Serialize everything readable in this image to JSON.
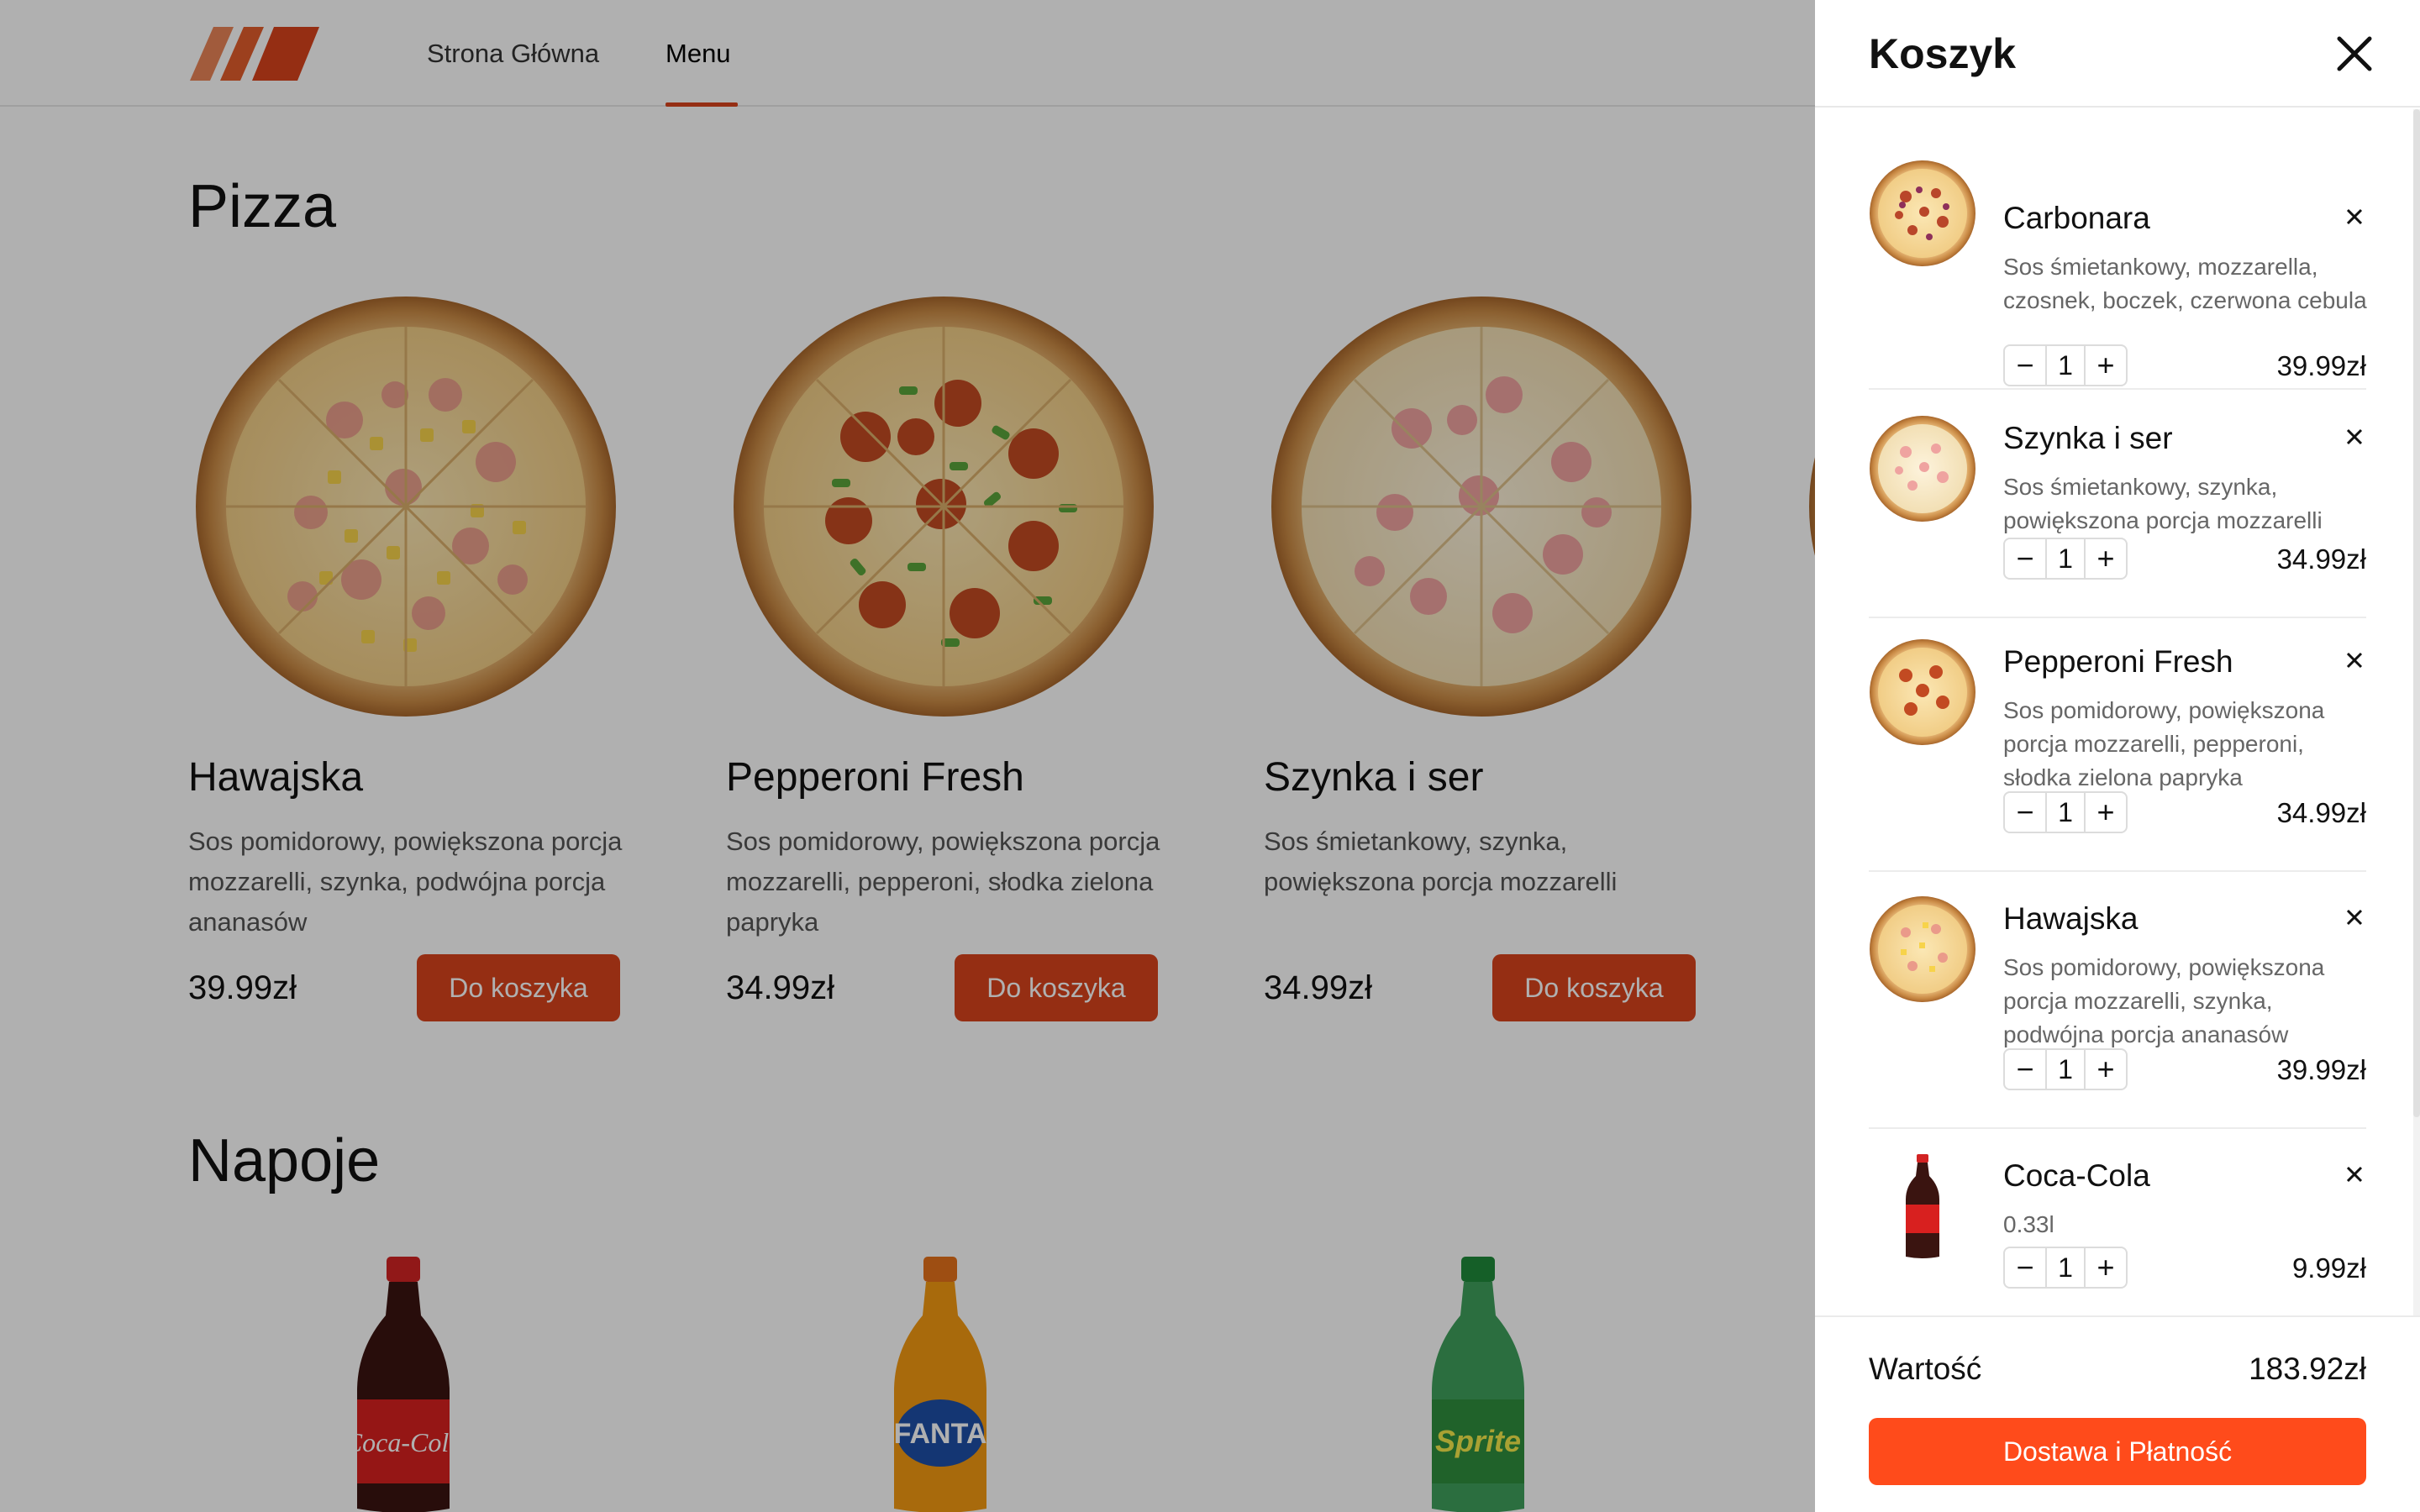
{
  "header": {
    "nav": [
      {
        "label": "Strona Główna",
        "active": false
      },
      {
        "label": "Menu",
        "active": true
      }
    ]
  },
  "sections": {
    "pizza_title": "Pizza",
    "drinks_title": "Napoje"
  },
  "products": [
    {
      "name": "Hawajska",
      "description": "Sos pomidorowy, powiększona porcja mozzarelli, szynka, podwójna porcja ananasów",
      "price": "39.99zł",
      "button": "Do koszyka",
      "image": "pizza-hawajska"
    },
    {
      "name": "Pepperoni Fresh",
      "description": "Sos pomidorowy, powiększona porcja mozzarelli, pepperoni, słodka zielona papryka",
      "price": "34.99zł",
      "button": "Do koszyka",
      "image": "pizza-pepperoni"
    },
    {
      "name": "Szynka i ser",
      "description": "Sos śmietankowy, szynka, powiększona porcja mozzarelli",
      "price": "34.99zł",
      "button": "Do koszyka",
      "image": "pizza-szynka"
    }
  ],
  "drinks": [
    {
      "image": "coca-cola-bottle"
    },
    {
      "image": "fanta-bottle"
    },
    {
      "image": "sprite-bottle"
    }
  ],
  "cart": {
    "title": "Koszyk",
    "items": [
      {
        "name": "Carbonara",
        "description": "Sos śmietankowy, mozzarella, czosnek, boczek, czerwona cebula",
        "quantity": "1",
        "price": "39.99zł"
      },
      {
        "name": "Szynka i ser",
        "description": "Sos śmietankowy, szynka, powiększona porcja mozzarelli",
        "quantity": "1",
        "price": "34.99zł"
      },
      {
        "name": "Pepperoni Fresh",
        "description": "Sos pomidorowy, powiększona porcja mozzarelli, pepperoni, słodka zielona papryka",
        "quantity": "1",
        "price": "34.99zł"
      },
      {
        "name": "Hawajska",
        "description": "Sos pomidorowy, powiększona porcja mozzarelli, szynka, podwójna porcja ananasów",
        "quantity": "1",
        "price": "39.99zł"
      },
      {
        "name": "Coca-Cola",
        "description": "0.33l",
        "quantity": "1",
        "price": "9.99zł"
      }
    ],
    "total_label": "Wartość",
    "total_value": "183.92zł",
    "checkout_label": "Dostawa i Płatność"
  },
  "colors": {
    "accent": "#d8431c",
    "checkout": "#ff4b1b",
    "overlay": "rgba(0,0,0,0.31)"
  }
}
